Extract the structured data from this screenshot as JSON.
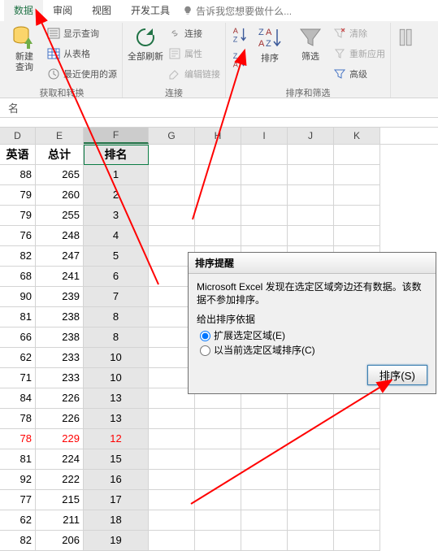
{
  "ribbon": {
    "tabs": [
      "数据",
      "审阅",
      "视图",
      "开发工具"
    ],
    "active_tab": "数据",
    "tellme": "告诉我您想要做什么...",
    "groups": {
      "get": {
        "new_query": "新建\n查询",
        "show_queries": "显示查询",
        "from_table": "从表格",
        "recent_sources": "最近使用的源",
        "label": "获取和转换"
      },
      "conn": {
        "refresh_all": "全部刷新",
        "connections": "连接",
        "properties": "属性",
        "edit_links": "编辑链接",
        "label": "连接"
      },
      "sort": {
        "sort_btn": "排序",
        "filter_btn": "筛选",
        "clear": "清除",
        "reapply": "重新应用",
        "advanced": "高级",
        "label": "排序和筛选"
      }
    }
  },
  "name_box": "名",
  "columns": [
    "D",
    "E",
    "F",
    "G",
    "H",
    "I",
    "J",
    "K"
  ],
  "header_row": {
    "D": "英语",
    "E": "总计",
    "F": "排名"
  },
  "rows": [
    {
      "D": "88",
      "E": "265",
      "F": "1"
    },
    {
      "D": "79",
      "E": "260",
      "F": "2"
    },
    {
      "D": "79",
      "E": "255",
      "F": "3"
    },
    {
      "D": "76",
      "E": "248",
      "F": "4"
    },
    {
      "D": "82",
      "E": "247",
      "F": "5"
    },
    {
      "D": "68",
      "E": "241",
      "F": "6"
    },
    {
      "D": "90",
      "E": "239",
      "F": "7"
    },
    {
      "D": "81",
      "E": "238",
      "F": "8"
    },
    {
      "D": "66",
      "E": "238",
      "F": "8"
    },
    {
      "D": "62",
      "E": "233",
      "F": "10"
    },
    {
      "D": "71",
      "E": "233",
      "F": "10"
    },
    {
      "D": "84",
      "E": "226",
      "F": "13"
    },
    {
      "D": "78",
      "E": "226",
      "F": "13"
    },
    {
      "D": "78",
      "E": "229",
      "F": "12",
      "red": true
    },
    {
      "D": "81",
      "E": "224",
      "F": "15"
    },
    {
      "D": "92",
      "E": "222",
      "F": "16"
    },
    {
      "D": "77",
      "E": "215",
      "F": "17"
    },
    {
      "D": "62",
      "E": "211",
      "F": "18"
    },
    {
      "D": "82",
      "E": "206",
      "F": "19"
    }
  ],
  "dialog": {
    "title": "排序提醒",
    "text": "Microsoft Excel 发现在选定区域旁边还有数据。该数据不参加排序。",
    "legend": "给出排序依据",
    "opt1": "扩展选定区域(E)",
    "opt2": "以当前选定区域排序(C)",
    "btn_sort": "排序(S)"
  }
}
